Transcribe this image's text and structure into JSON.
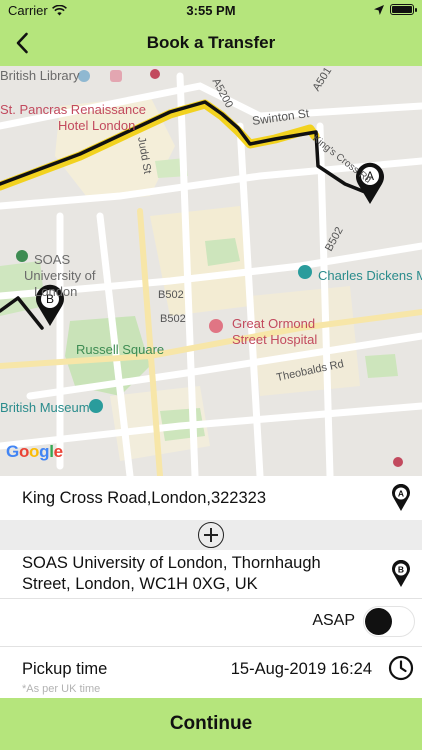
{
  "status_bar": {
    "carrier": "Carrier",
    "time": "3:55 PM"
  },
  "nav": {
    "title": "Book a Transfer"
  },
  "map": {
    "labels": {
      "british_library": "British Library",
      "st_pancras": "St. Pancras Renaissance",
      "hotel_london": "Hotel London",
      "judd_st": "Judd St",
      "swinton_st": "Swinton St",
      "a501": "A501",
      "a5200": "A5200",
      "kings_cross_rd": "King's Cross Rd",
      "b502_a": "B502",
      "b502_b": "B502",
      "b502_c": "B502",
      "charles_dickens": "Charles Dickens M",
      "soas_1": "SOAS",
      "soas_2": "University of",
      "soas_3": "London",
      "russell_square": "Russell Square",
      "great_ormond_1": "Great Ormond",
      "great_ormond_2": "Street Hospital",
      "theobalds_rd": "Theobalds Rd",
      "british_museum": "British Museum",
      "google": {
        "g1": "G",
        "o1": "o",
        "o2": "o",
        "g2": "g",
        "l": "l",
        "e": "e"
      }
    },
    "markers": {
      "a": "A",
      "b": "B"
    }
  },
  "pickup": {
    "address": "King Cross Road,London,322323",
    "pin_letter": "A"
  },
  "dropoff": {
    "address_line1": "SOAS University of London, Thornhaugh",
    "address_line2": "Street, London,  WC1H 0XG, UK",
    "pin_letter": "B"
  },
  "asap": {
    "label": "ASAP",
    "enabled": false
  },
  "pickup_time": {
    "label": "Pickup time",
    "value": "15-Aug-2019 16:24",
    "note": "*As per UK time"
  },
  "continue_label": "Continue",
  "colors": {
    "accent": "#b5e57c",
    "route": "#111111",
    "highlight_route": "#f2d21f"
  }
}
